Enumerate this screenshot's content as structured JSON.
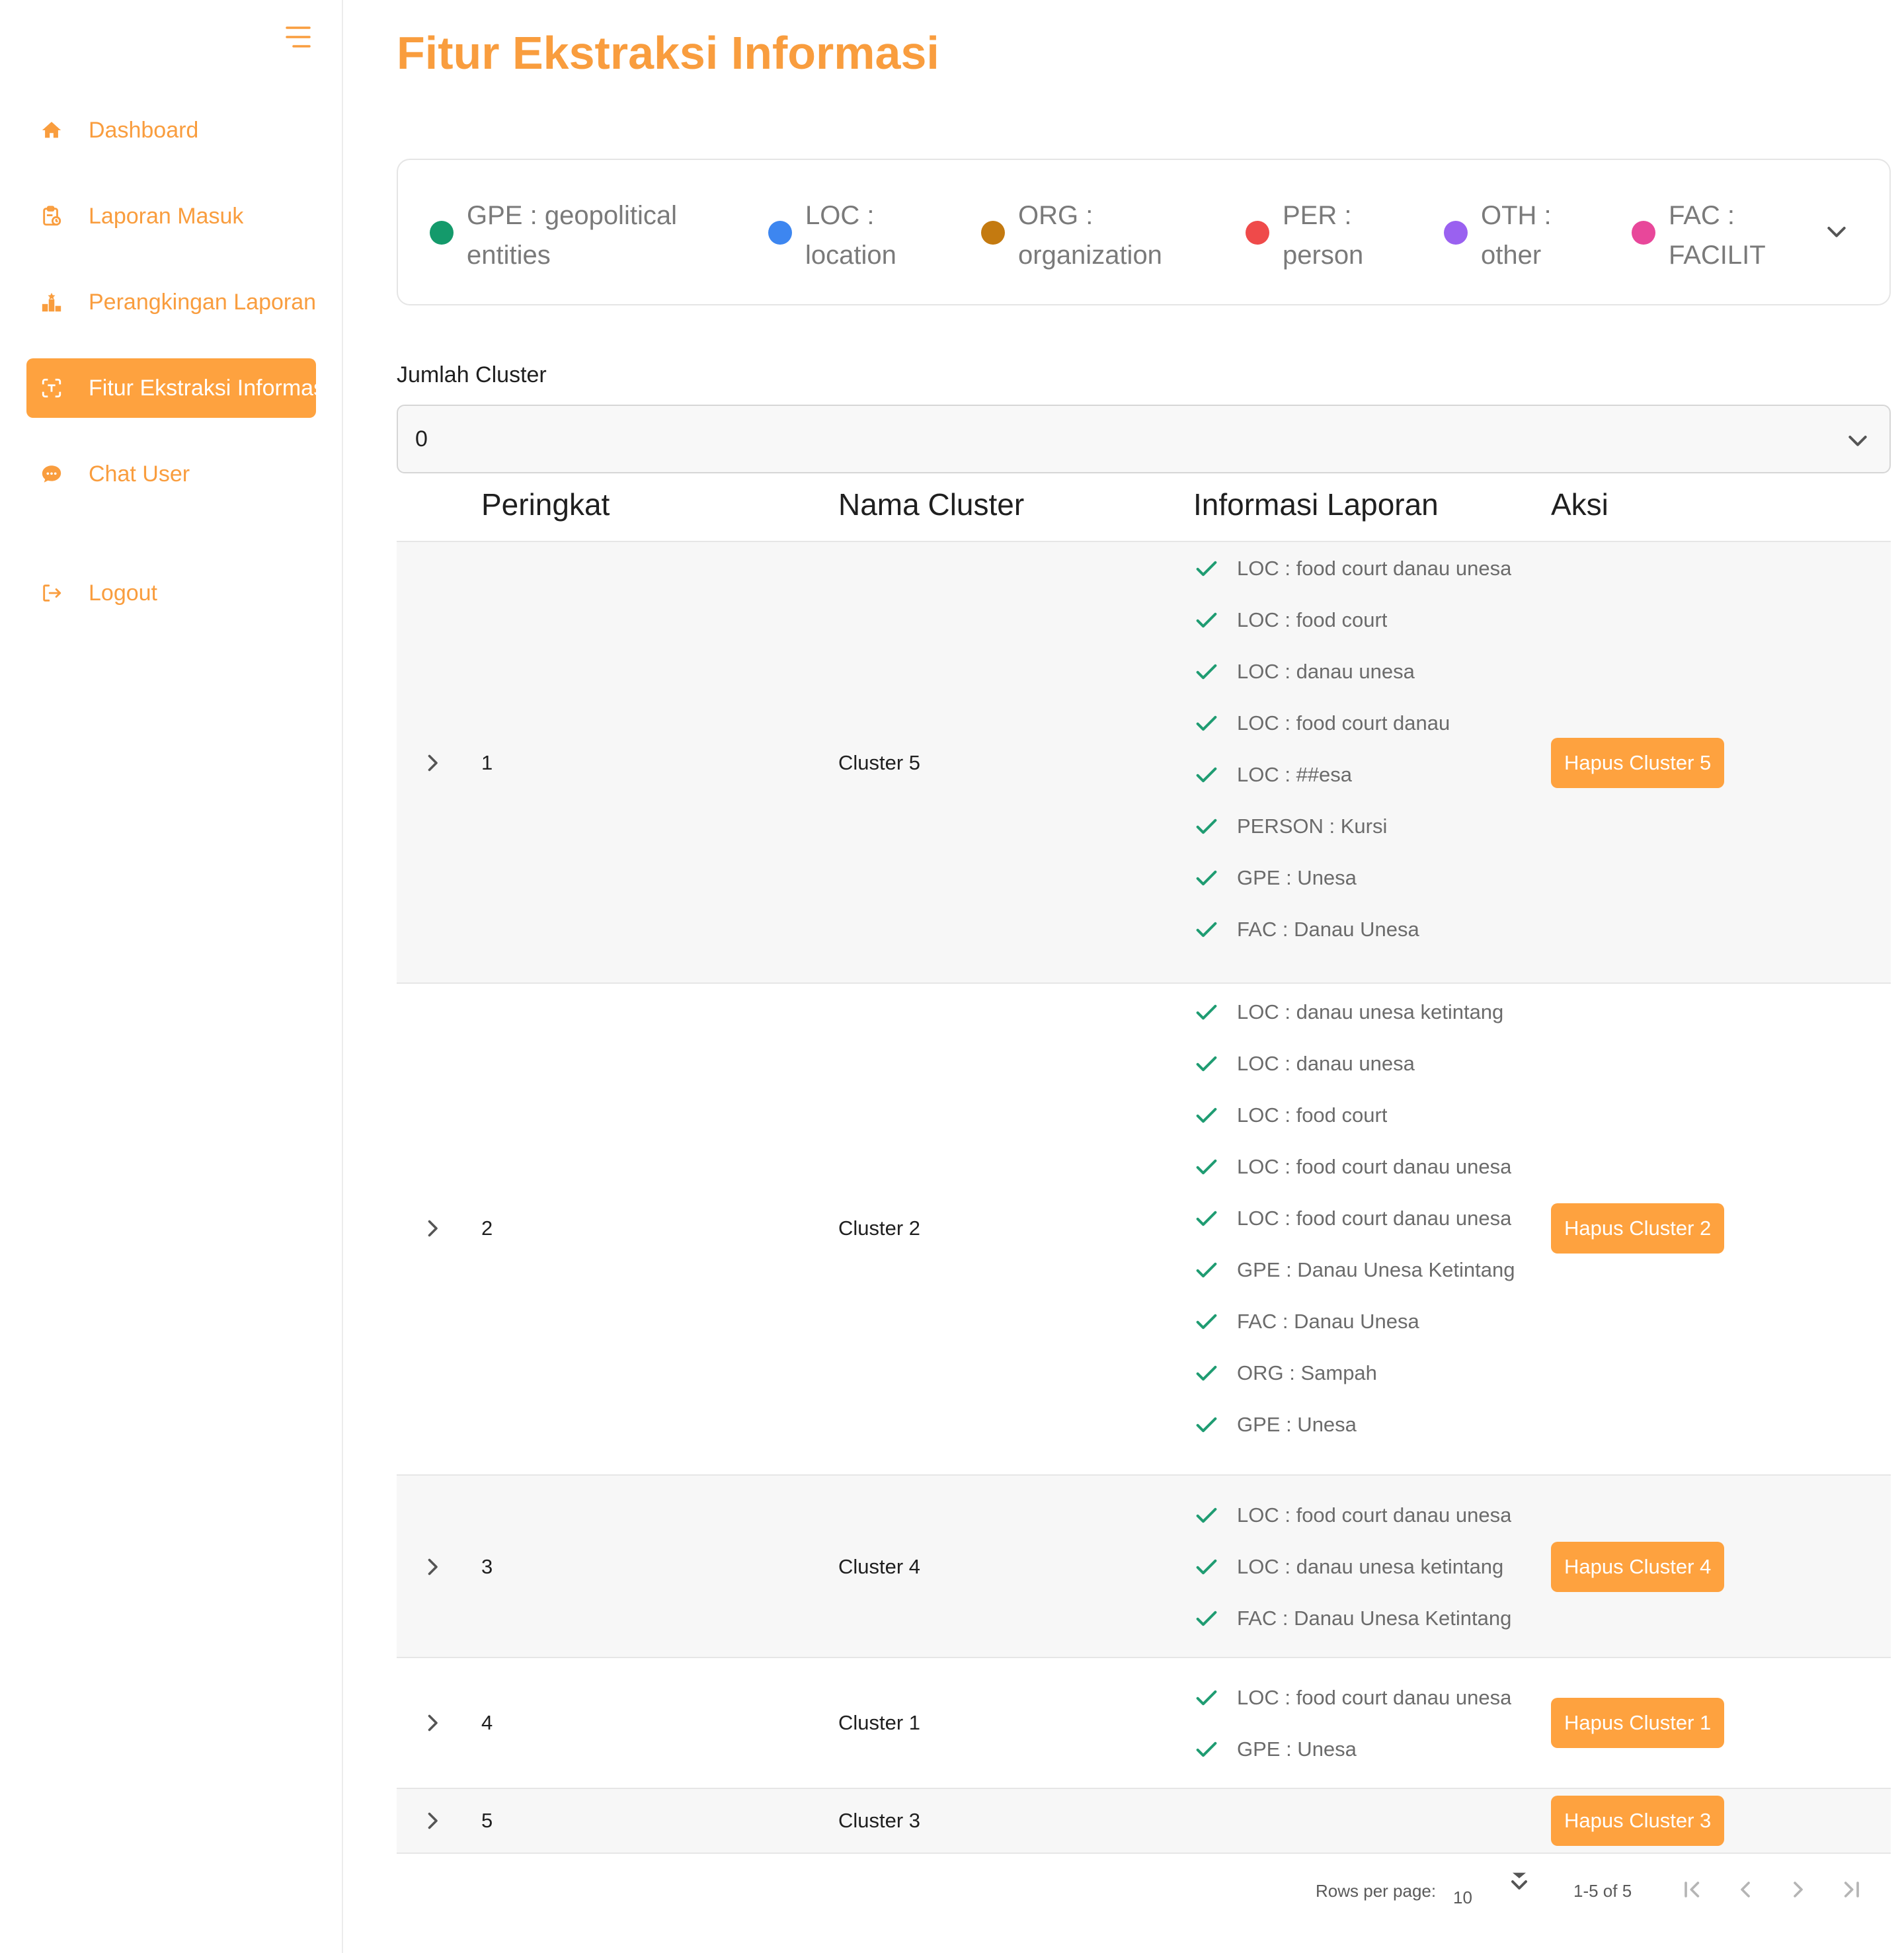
{
  "colors": {
    "accent": "#fea23f",
    "accent_text": "#f99d3e",
    "check": "#1f9c72"
  },
  "sidebar": {
    "menu_icon": "hamburger-icon",
    "items": [
      {
        "label": "Dashboard",
        "icon": "home-icon"
      },
      {
        "label": "Laporan Masuk",
        "icon": "clipboard-icon"
      },
      {
        "label": "Perangkingan Laporan",
        "icon": "ranking-icon"
      },
      {
        "label": "Fitur Ekstraksi Informasi",
        "icon": "scan-text-icon",
        "active": true
      },
      {
        "label": "Chat User",
        "icon": "chat-icon"
      },
      {
        "label": "Logout",
        "icon": "logout-icon"
      }
    ]
  },
  "page": {
    "title": "Fitur Ekstraksi Informasi"
  },
  "legend": {
    "items": [
      {
        "code": "GPE :",
        "desc": "geopolitical entities",
        "color": "#149a6b"
      },
      {
        "code": "LOC :",
        "desc": "location",
        "color": "#3d86f0"
      },
      {
        "code": "ORG :",
        "desc": "organization",
        "color": "#c47a10"
      },
      {
        "code": "PER :",
        "desc": "person",
        "color": "#ef4a4a"
      },
      {
        "code": "OTH :",
        "desc": "other",
        "color": "#9a61f0"
      },
      {
        "code": "FAC :",
        "desc": "FACILIT",
        "color": "#e8479a"
      }
    ]
  },
  "cluster_select": {
    "label": "Jumlah Cluster",
    "value": "0"
  },
  "table": {
    "headers": {
      "rank": "Peringkat",
      "name": "Nama Cluster",
      "info": "Informasi Laporan",
      "action": "Aksi"
    },
    "rows": [
      {
        "rank": "1",
        "name": "Cluster 5",
        "button": "Hapus Cluster 5",
        "info": [
          "LOC : food court danau unesa",
          "LOC : food court",
          "LOC : danau unesa",
          "LOC : food court danau",
          "LOC : ##esa",
          "PERSON : Kursi",
          "GPE : Unesa",
          "FAC : Danau Unesa"
        ]
      },
      {
        "rank": "2",
        "name": "Cluster 2",
        "button": "Hapus Cluster 2",
        "info": [
          "LOC : danau unesa ketintang",
          "LOC : danau unesa",
          "LOC : food court",
          "LOC : food court danau unesa",
          "LOC : food court danau unesa",
          "GPE : Danau Unesa Ketintang",
          "FAC : Danau Unesa",
          "ORG : Sampah",
          "GPE : Unesa"
        ]
      },
      {
        "rank": "3",
        "name": "Cluster 4",
        "button": "Hapus Cluster 4",
        "info": [
          "LOC : food court danau unesa",
          "LOC : danau unesa ketintang",
          "FAC : Danau Unesa Ketintang"
        ]
      },
      {
        "rank": "4",
        "name": "Cluster 1",
        "button": "Hapus Cluster 1",
        "info": [
          "LOC : food court danau unesa",
          "GPE : Unesa"
        ]
      },
      {
        "rank": "5",
        "name": "Cluster 3",
        "button": "Hapus Cluster 3",
        "info": []
      }
    ]
  },
  "pagination": {
    "rows_per_page_label": "Rows per page:",
    "rows_per_page": "10",
    "range": "1-5 of 5"
  }
}
